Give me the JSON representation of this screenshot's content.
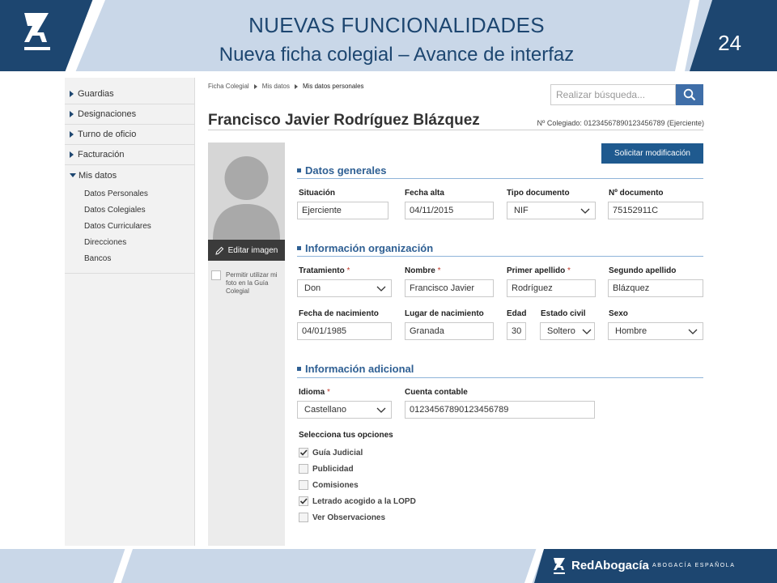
{
  "slide": {
    "title": "NUEVAS FUNCIONALIDADES",
    "subtitle": "Nueva ficha colegial – Avance de interfaz",
    "page_number": "24",
    "footer_brand": "RedAbogacía",
    "footer_sub": "ABOGACÍA ESPAÑOLA"
  },
  "colors": {
    "brand_dark": "#1d4670",
    "band_light": "#c9d7e8",
    "accent_blue": "#2e5f93",
    "button_blue": "#1f5a8f"
  },
  "sidebar": {
    "items": [
      {
        "label": "Guardias"
      },
      {
        "label": "Designaciones"
      },
      {
        "label": "Turno de oficio"
      },
      {
        "label": "Facturación"
      },
      {
        "label": "Mis datos"
      }
    ],
    "subitems": [
      {
        "label": "Datos Personales"
      },
      {
        "label": "Datos Colegiales"
      },
      {
        "label": "Datos Curriculares"
      },
      {
        "label": "Direcciones"
      },
      {
        "label": "Bancos"
      }
    ]
  },
  "breadcrumb": {
    "items": [
      "Ficha Colegial",
      "Mis datos",
      "Mis datos personales"
    ]
  },
  "search": {
    "placeholder": "Realizar búsqueda..."
  },
  "person": {
    "name": "Francisco Javier Rodríguez Blázquez",
    "colegiado": "Nº Colegiado: 01234567890123456789 (Ejerciente)"
  },
  "photo": {
    "edit_label": "Editar imagen",
    "permit_label": "Permitir utilizar mi foto en la Guía Colegial",
    "permit_checked": false
  },
  "actions": {
    "solicitar": "Solicitar modificación"
  },
  "datos_generales": {
    "title": "Datos generales",
    "situacion_label": "Situación",
    "situacion_value": "Ejerciente",
    "fecha_alta_label": "Fecha alta",
    "fecha_alta_value": "04/11/2015",
    "tipo_doc_label": "Tipo documento",
    "tipo_doc_value": "NIF",
    "num_doc_label": "Nº documento",
    "num_doc_value": "75152911C"
  },
  "info_organizacion": {
    "title": "Información organización",
    "tratamiento_label": "Tratamiento",
    "tratamiento_value": "Don",
    "nombre_label": "Nombre",
    "nombre_value": "Francisco Javier",
    "apellido1_label": "Primer apellido",
    "apellido1_value": "Rodríguez",
    "apellido2_label": "Segundo apellido",
    "apellido2_value": "Blázquez",
    "nacimiento_label": "Fecha de nacimiento",
    "nacimiento_value": "04/01/1985",
    "lugar_label": "Lugar de nacimiento",
    "lugar_value": "Granada",
    "edad_label": "Edad",
    "edad_value": "30",
    "estado_label": "Estado civil",
    "estado_value": "Soltero",
    "sexo_label": "Sexo",
    "sexo_value": "Hombre",
    "required_mark": "*"
  },
  "info_adicional": {
    "title": "Información adicional",
    "idioma_label": "Idioma",
    "idioma_value": "Castellano",
    "cuenta_label": "Cuenta contable",
    "cuenta_value": "01234567890123456789",
    "opciones_title": "Selecciona tus opciones",
    "opciones": [
      {
        "label": "Guía Judicial",
        "checked": true
      },
      {
        "label": "Publicidad",
        "checked": false
      },
      {
        "label": "Comisiones",
        "checked": false
      },
      {
        "label": "Letrado acogido a la LOPD",
        "checked": true
      },
      {
        "label": "Ver Observaciones",
        "checked": false
      }
    ]
  }
}
